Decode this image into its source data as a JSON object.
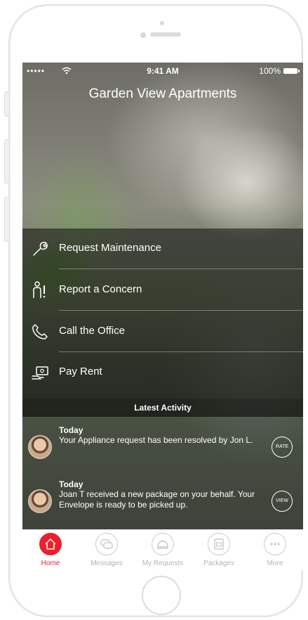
{
  "status_bar": {
    "signal": "•••••",
    "time": "9:41 AM",
    "battery": "100%"
  },
  "header": {
    "title": "Garden View Apartments"
  },
  "menu": [
    {
      "label": "Request Maintenance",
      "icon": "wrench-icon"
    },
    {
      "label": "Report a Concern",
      "icon": "person-alert-icon"
    },
    {
      "label": "Call the Office",
      "icon": "phone-icon"
    },
    {
      "label": "Pay Rent",
      "icon": "hand-money-icon"
    }
  ],
  "activity": {
    "header": "Latest Activity",
    "items": [
      {
        "day": "Today",
        "text": "Your Appliance request has been resolved by Jon L.",
        "action": "RATE"
      },
      {
        "day": "Today",
        "text": "Joan T received a new package on your behalf. Your Envelope is ready to be picked up.",
        "action": "VIEW"
      }
    ]
  },
  "tabs": [
    {
      "label": "Home",
      "icon": "home-icon",
      "active": true
    },
    {
      "label": "Messages",
      "icon": "chat-icon"
    },
    {
      "label": "My Requests",
      "icon": "service-bell-icon"
    },
    {
      "label": "Packages",
      "icon": "package-icon"
    },
    {
      "label": "More",
      "icon": "more-icon"
    }
  ],
  "colors": {
    "accent": "#ee1f2d",
    "tab_inactive": "#b4b4b4"
  }
}
